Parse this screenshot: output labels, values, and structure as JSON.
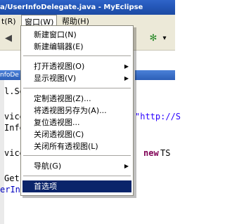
{
  "window": {
    "title": "a/UserInfoDelegate.java - MyEclipse"
  },
  "menubar": {
    "items": [
      {
        "label": "t(R)"
      },
      {
        "label": "窗口(W)"
      },
      {
        "label": "帮助(H)"
      }
    ]
  },
  "editor": {
    "tab_label": "nfoDe",
    "lines": [
      {
        "text": "l.Serv"
      },
      {
        "parts": [
          "vice",
          "",
          "\"http://S"
        ]
      },
      {
        "text": "Info"
      },
      {
        "parts": [
          "vice",
          " = ",
          "new",
          " TS"
        ]
      },
      {
        "text": " Get"
      },
      {
        "text": "erIn"
      }
    ]
  },
  "window_menu": {
    "items": [
      {
        "label": "新建窗口(N)",
        "submenu": false
      },
      {
        "label": "新建编辑器(E)",
        "submenu": false
      },
      {
        "separator": true
      },
      {
        "label": "打开透视图(O)",
        "submenu": true
      },
      {
        "label": "显示视图(V)",
        "submenu": true
      },
      {
        "separator": true
      },
      {
        "label": "定制透视图(Z)...",
        "submenu": false
      },
      {
        "label": "将透视图另存为(A)...",
        "submenu": false
      },
      {
        "label": "复位透视图...",
        "submenu": false
      },
      {
        "label": "关闭透视图(C)",
        "submenu": false
      },
      {
        "label": "关闭所有透视图(L)",
        "submenu": false
      },
      {
        "separator": true
      },
      {
        "label": "导航(G)",
        "submenu": true
      },
      {
        "separator": true
      },
      {
        "label": "首选项",
        "submenu": false,
        "selected": true
      }
    ]
  },
  "colors": {
    "title_bar": "#2457b8",
    "selection": "#0a246a",
    "keyword": "#7f0055",
    "string": "#2a00ff"
  },
  "icons": {
    "submenu_arrow": "▶",
    "toolbar_star": "✻",
    "toolbar_dropdown": "▾"
  }
}
